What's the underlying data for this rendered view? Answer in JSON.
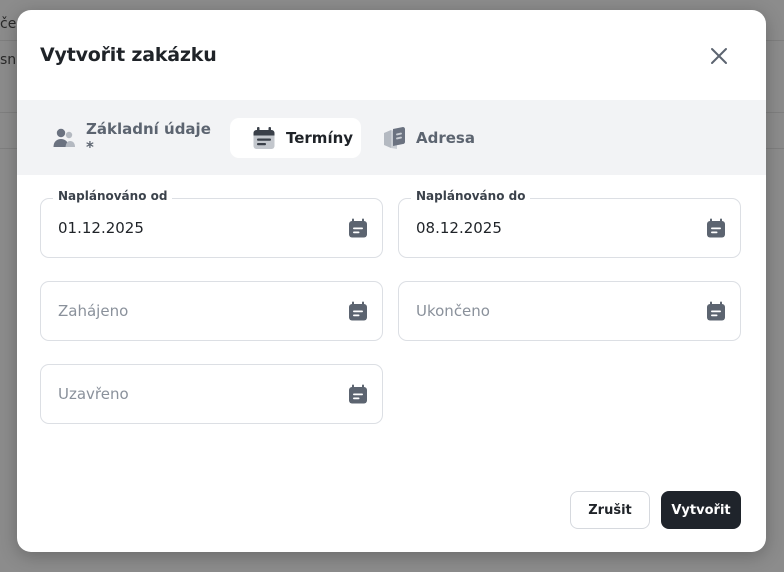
{
  "background": {
    "fragments": [
      "če",
      "sn"
    ]
  },
  "modal": {
    "title": "Vytvořit zakázku",
    "close_icon": "close-icon"
  },
  "tabs": [
    {
      "label": "Základní údaje *",
      "icon": "users-icon",
      "active": false
    },
    {
      "label": "Termíny",
      "icon": "calendar-icon",
      "active": true
    },
    {
      "label": "Adresa",
      "icon": "map-icon",
      "active": false
    }
  ],
  "fields": {
    "planned_from": {
      "label": "Naplánováno od",
      "value": "01.12.2025"
    },
    "planned_to": {
      "label": "Naplánováno do",
      "value": "08.12.2025"
    },
    "started": {
      "placeholder": "Zahájeno"
    },
    "ended": {
      "placeholder": "Ukončeno"
    },
    "closed": {
      "placeholder": "Uzavřeno"
    }
  },
  "buttons": {
    "cancel": "Zrušit",
    "create": "Vytvořit"
  },
  "colors": {
    "accent_dark": "#1f242b",
    "icon_gray": "#5c6470",
    "tabs_bg": "#f2f3f5"
  }
}
